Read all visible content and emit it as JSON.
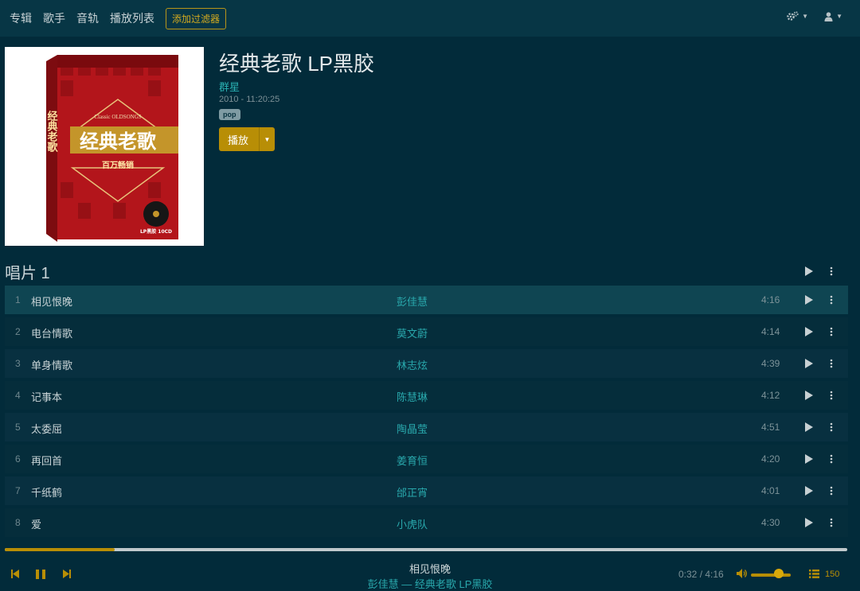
{
  "nav": {
    "links": [
      "专辑",
      "歌手",
      "音轨",
      "播放列表"
    ],
    "filter_button": "添加过滤器"
  },
  "album": {
    "title": "经典老歌 LP黑胶",
    "artist": "群星",
    "meta": "2010 - 11:20:25",
    "genre": "pop",
    "play_label": "播放",
    "cover": {
      "top_text": "Classic OLDSONGS",
      "main_text": "经典老歌",
      "sub_text": "百万畅销",
      "side_text": "经典老歌",
      "badge_text": "LP黑胶 10CD"
    }
  },
  "disc": {
    "title": "唱片 1"
  },
  "tracks": [
    {
      "num": "1",
      "title": "相见恨晚",
      "artist": "彭佳慧",
      "duration": "4:16"
    },
    {
      "num": "2",
      "title": "电台情歌",
      "artist": "莫文蔚",
      "duration": "4:14"
    },
    {
      "num": "3",
      "title": "单身情歌",
      "artist": "林志炫",
      "duration": "4:39"
    },
    {
      "num": "4",
      "title": "记事本",
      "artist": "陈慧琳",
      "duration": "4:12"
    },
    {
      "num": "5",
      "title": "太委屈",
      "artist": "陶晶莹",
      "duration": "4:51"
    },
    {
      "num": "6",
      "title": "再回首",
      "artist": "姜育恒",
      "duration": "4:20"
    },
    {
      "num": "7",
      "title": "千纸鹤",
      "artist": "邰正宵",
      "duration": "4:01"
    },
    {
      "num": "8",
      "title": "爱",
      "artist": "小虎队",
      "duration": "4:30"
    }
  ],
  "player": {
    "now_title": "相见恨晚",
    "now_subtitle": "彭佳慧 — 经典老歌 LP黑胶",
    "time": "0:32 / 4:16",
    "progress_fraction": 0.13,
    "volume_fraction": 0.7,
    "queue_count": "150"
  },
  "colors": {
    "background": "#022b3a",
    "accent": "#b88e06",
    "link": "#29a8ac"
  }
}
